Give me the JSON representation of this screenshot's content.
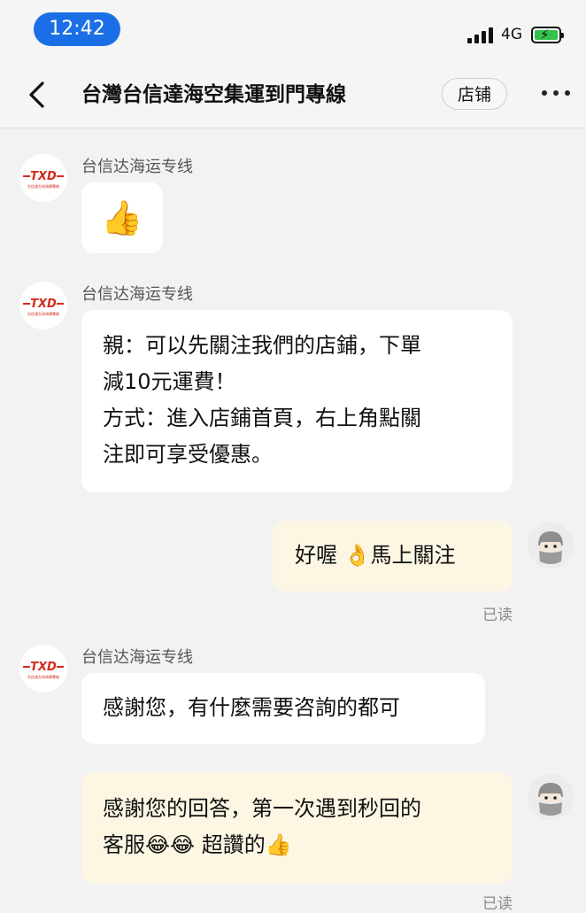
{
  "status_bar": {
    "time": "12:42",
    "network": "4G"
  },
  "header": {
    "title": "台灣台信達海空集運到門專線",
    "shop_button": "店铺"
  },
  "shop_logo": {
    "text": "TXD",
    "subtext": "台信達台灣海運專線"
  },
  "messages": [
    {
      "sender": "台信达海运专线",
      "type": "sticker",
      "content": "👍"
    },
    {
      "sender": "台信达海运专线",
      "type": "text",
      "content": "親：可以先關注我們的店鋪，下單\n減10元運費！\n方式：進入店鋪首頁，右上角點關\n注即可享受優惠。"
    },
    {
      "sender": "me",
      "type": "text",
      "content": "好喔 👌馬上關注",
      "status": "已读"
    },
    {
      "sender": "台信达海运专线",
      "type": "text",
      "content": "感謝您，有什麼需要咨詢的都可"
    },
    {
      "sender": "me",
      "type": "text",
      "content": "感謝您的回答，第一次遇到秒回的\n客服😂😂 超讚的👍",
      "status": "已读"
    }
  ],
  "colors": {
    "time_pill": "#1b6fe6",
    "my_bubble": "#fcf6e3",
    "logo_red": "#d42a1e"
  }
}
